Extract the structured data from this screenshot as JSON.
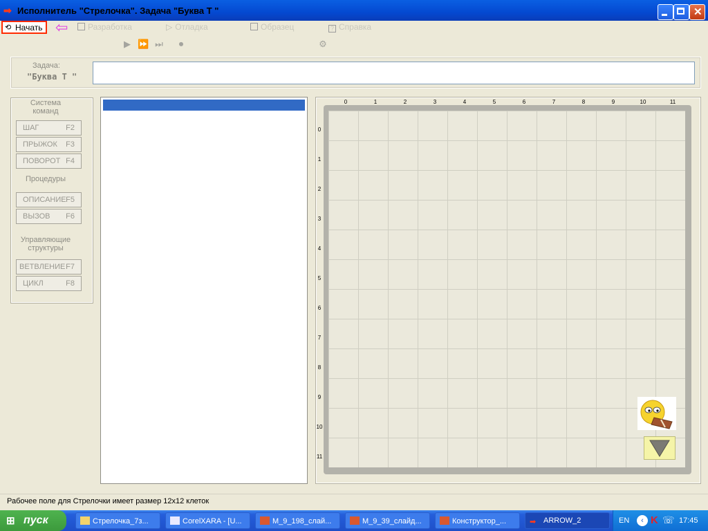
{
  "window": {
    "title": "Исполнитель \"Стрелочка\".  Задача  \"Буква Т \""
  },
  "menu": {
    "start": "Начать",
    "items": [
      "Разработка",
      "Отладка",
      "Образец",
      "Справка"
    ]
  },
  "task": {
    "label": "Задача:",
    "name": "\"Буква  Т \"",
    "value": ""
  },
  "commands": {
    "system_title": "Система\nкоманд",
    "system_buttons": [
      {
        "label": "ШАГ",
        "key": "F2"
      },
      {
        "label": "ПРЫЖОК",
        "key": "F3"
      },
      {
        "label": "ПОВОРОТ",
        "key": "F4"
      }
    ],
    "procedures_title": "Процедуры",
    "procedure_buttons": [
      {
        "label": "ОПИСАНИЕ",
        "key": "F5"
      },
      {
        "label": "ВЫЗОВ",
        "key": "F6"
      }
    ],
    "control_title": "Управляющие\nструктуры",
    "control_buttons": [
      {
        "label": "ВЕТВЛЕНИЕ",
        "key": "F7"
      },
      {
        "label": "ЦИКЛ",
        "key": "F8"
      }
    ]
  },
  "field": {
    "columns": [
      "0",
      "1",
      "2",
      "3",
      "4",
      "5",
      "6",
      "7",
      "8",
      "9",
      "10",
      "11"
    ],
    "rows": [
      "0",
      "1",
      "2",
      "3",
      "4",
      "5",
      "6",
      "7",
      "8",
      "9",
      "10",
      "11"
    ]
  },
  "status": {
    "text": "Рабочее поле для Стрелочки имеет размер 12x12 клеток"
  },
  "taskbar": {
    "start": "пуск",
    "items": [
      "Стрелочка_7з...",
      "CorelXARA - [U...",
      "M_9_198_слай...",
      "M_9_39_слайд...",
      "Конструктор_...",
      "ARROW_2"
    ],
    "lang": "EN",
    "clock": "17:45"
  }
}
